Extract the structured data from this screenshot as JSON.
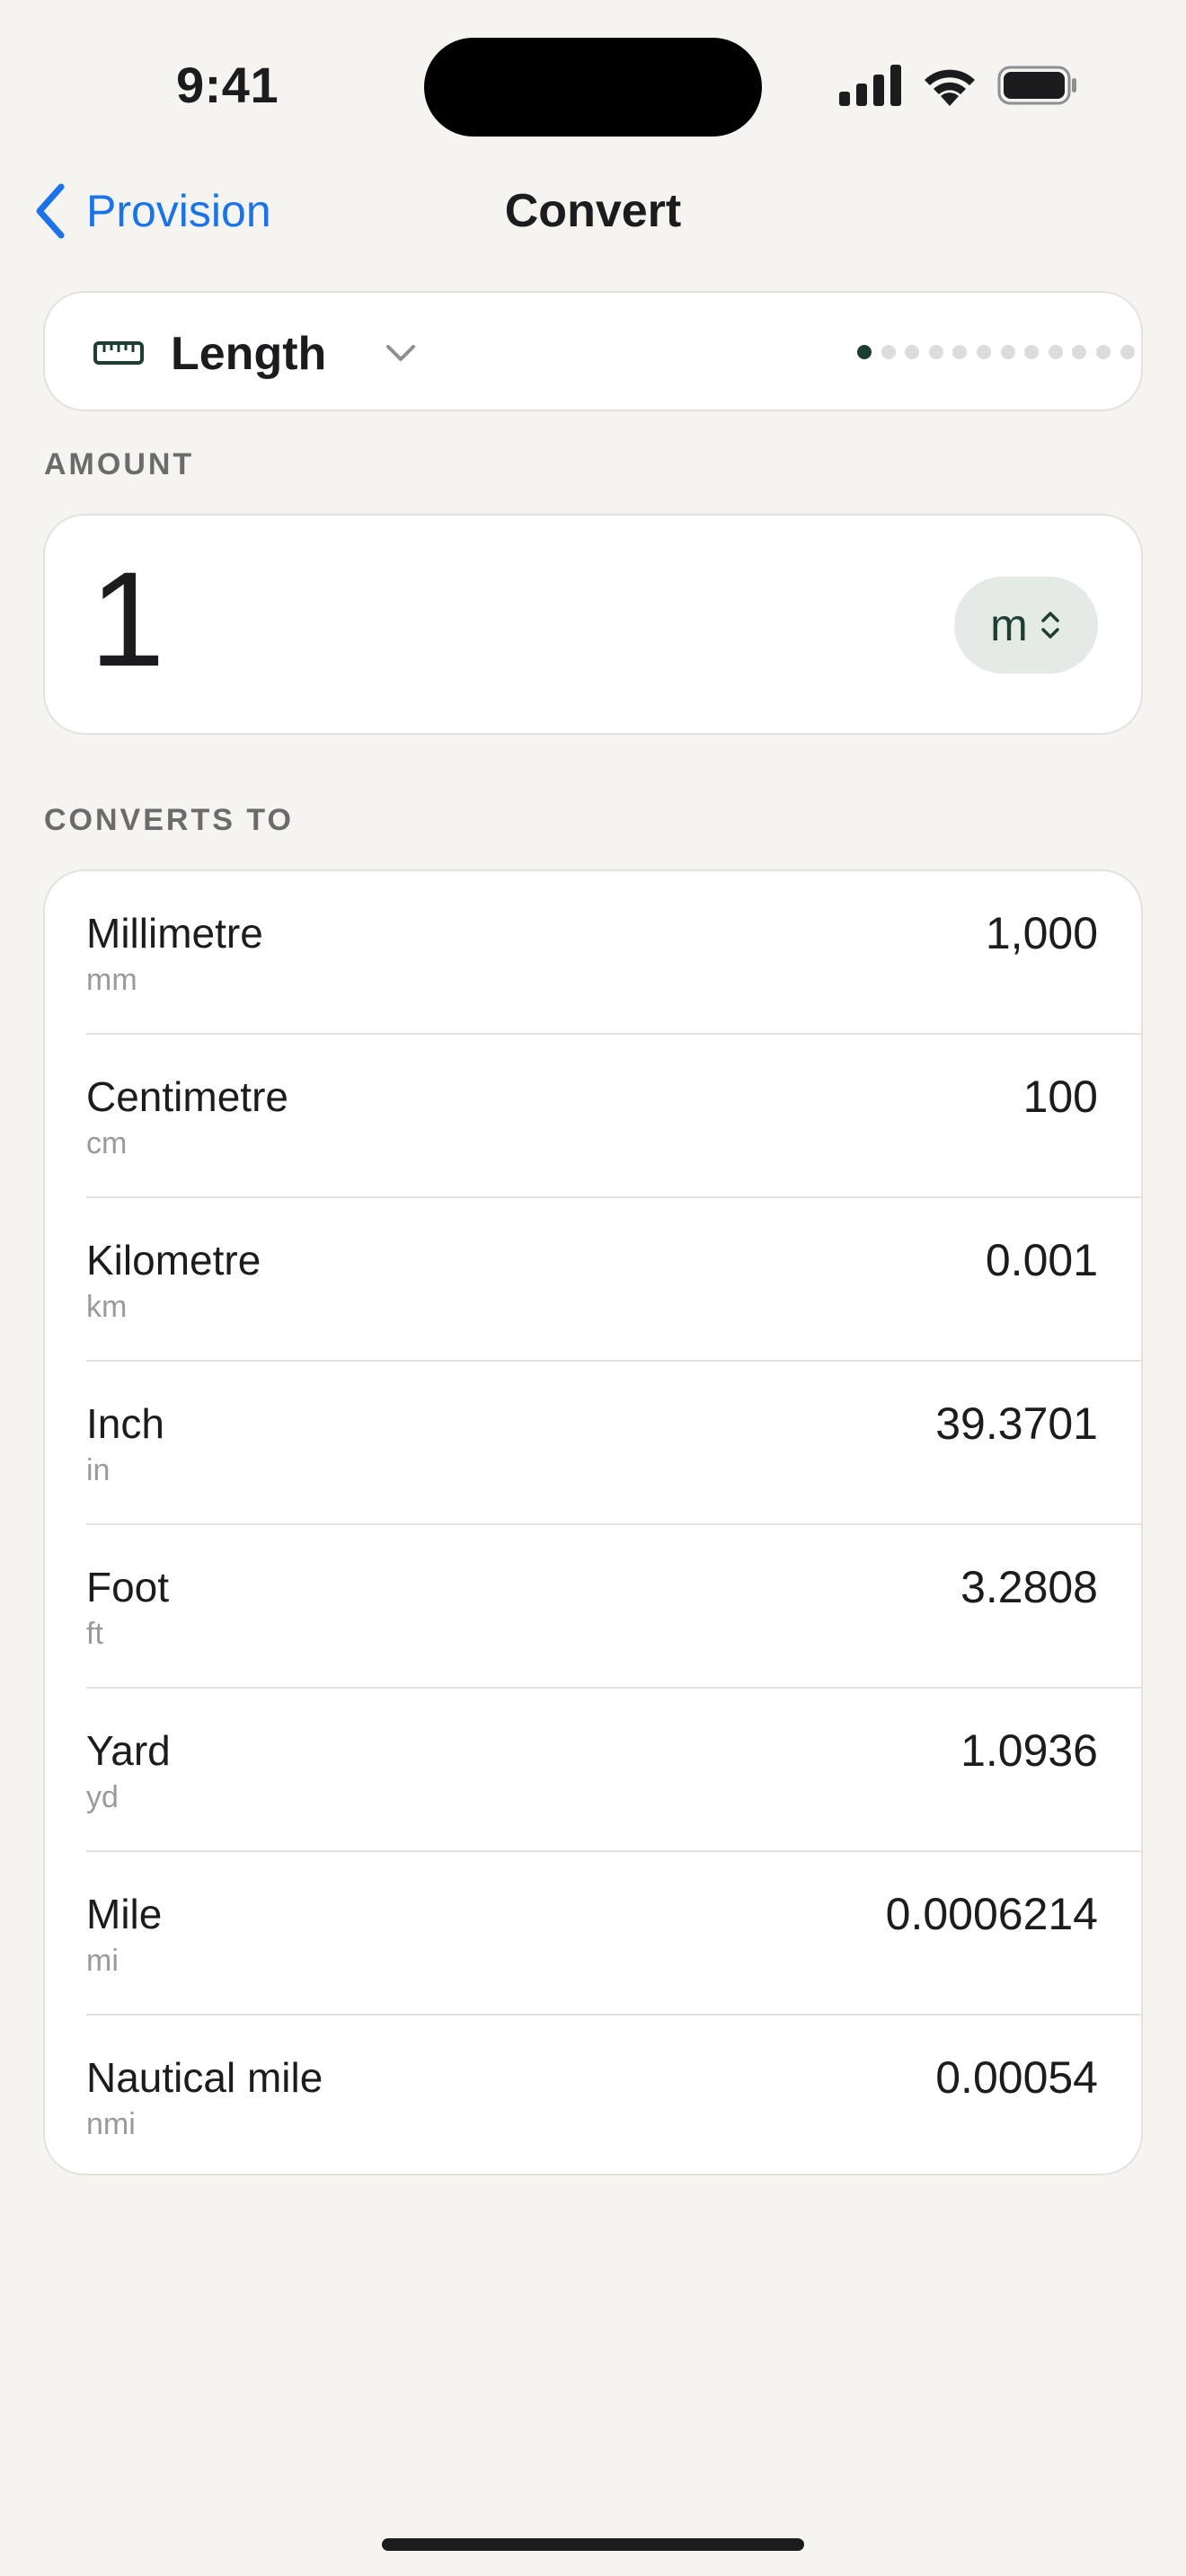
{
  "status_bar": {
    "time": "9:41",
    "icons": [
      "signal-icon",
      "wifi-icon",
      "battery-icon"
    ]
  },
  "nav": {
    "back_label": "Provision",
    "title": "Convert"
  },
  "category": {
    "icon": "ruler-icon",
    "label": "Length",
    "page_count": 12,
    "active_page": 1
  },
  "amount": {
    "section_label": "AMOUNT",
    "value": "1",
    "unit": "m"
  },
  "conversions": {
    "section_label": "CONVERTS TO",
    "rows": [
      {
        "name": "Millimetre",
        "abbr": "mm",
        "value": "1,000"
      },
      {
        "name": "Centimetre",
        "abbr": "cm",
        "value": "100"
      },
      {
        "name": "Kilometre",
        "abbr": "km",
        "value": "0.001"
      },
      {
        "name": "Inch",
        "abbr": "in",
        "value": "39.3701"
      },
      {
        "name": "Foot",
        "abbr": "ft",
        "value": "3.2808"
      },
      {
        "name": "Yard",
        "abbr": "yd",
        "value": "1.0936"
      },
      {
        "name": "Mile",
        "abbr": "mi",
        "value": "0.0006214"
      },
      {
        "name": "Nautical mile",
        "abbr": "nmi",
        "value": "0.00054"
      }
    ]
  },
  "colors": {
    "accent": "#1a73e8",
    "brand_green": "#1e3d33",
    "pill_bg": "#e4ebe7",
    "background": "#f5f4f1"
  }
}
